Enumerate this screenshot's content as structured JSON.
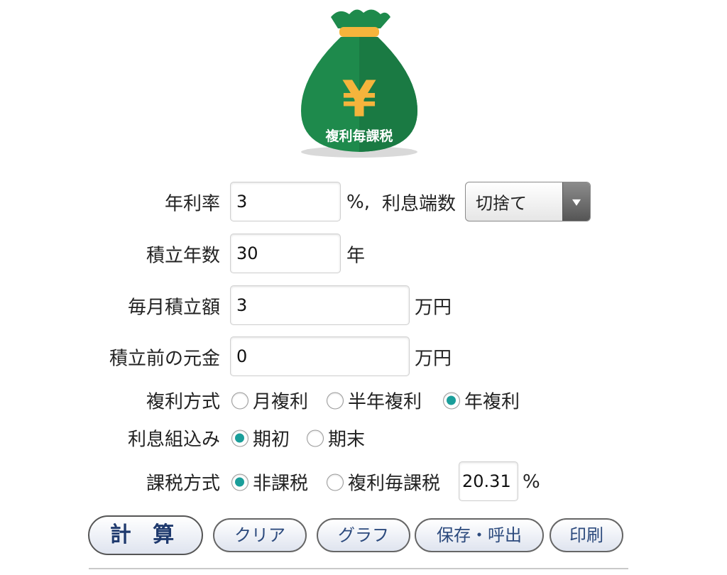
{
  "logo": {
    "icon": "money-bag-yen-icon",
    "symbol": "¥",
    "caption": "複利毎課税",
    "bag_color": "#1e8a4c",
    "accent_color": "#f5b43c"
  },
  "form": {
    "rate": {
      "label": "年利率",
      "value": "3",
      "unit": "%,",
      "rounding_label": "利息端数",
      "rounding_value": "切捨て"
    },
    "years": {
      "label": "積立年数",
      "value": "30",
      "unit": "年"
    },
    "monthly": {
      "label": "毎月積立額",
      "value": "3",
      "unit": "万円"
    },
    "principal": {
      "label": "積立前の元金",
      "value": "0",
      "unit": "万円"
    },
    "compounding": {
      "label": "複利方式",
      "options": [
        "月複利",
        "半年複利",
        "年複利"
      ],
      "selected": "年複利"
    },
    "timing": {
      "label": "利息組込み",
      "options": [
        "期初",
        "期末"
      ],
      "selected": "期初"
    },
    "tax": {
      "label": "課税方式",
      "options": [
        "非課税",
        "複利毎課税"
      ],
      "selected": "非課税",
      "rate_value": "20.31",
      "rate_unit": "%"
    }
  },
  "buttons": {
    "calculate": "計 算",
    "clear": "クリア",
    "graph": "グラフ",
    "save_load": "保存・呼出",
    "print": "印刷"
  },
  "colors": {
    "radio_selected": "#1a9e9a",
    "button_text": "#2c4a7d"
  }
}
